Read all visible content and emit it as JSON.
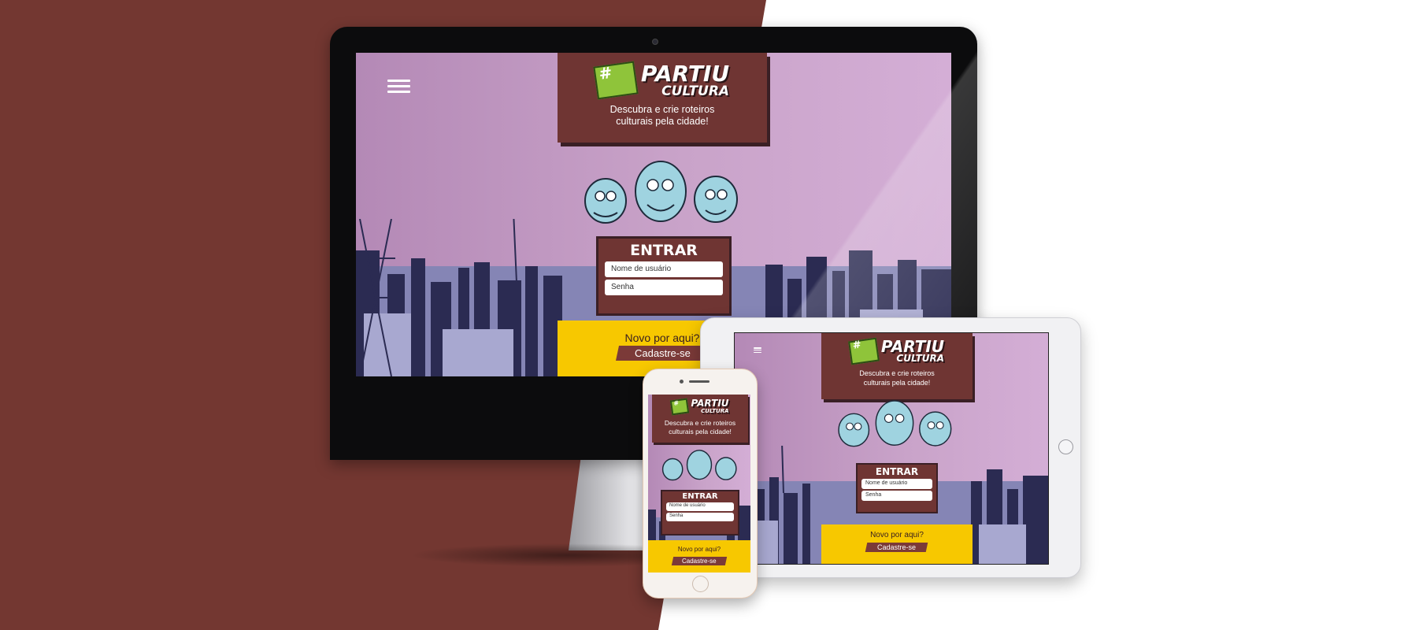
{
  "brand": {
    "logo_line1": "PARTIU",
    "logo_line2": "CULTURA",
    "hash_symbol": "#",
    "tagline_line1": "Descubra e crie roteiros",
    "tagline_line2": "culturais pela cidade!"
  },
  "login": {
    "title": "ENTRAR",
    "username_placeholder": "Nome de usuário",
    "password_placeholder": "Senha"
  },
  "signup": {
    "question": "Novo por aqui?",
    "button_label": "Cadastre-se"
  },
  "icons": {
    "menu": "hamburger-menu-icon"
  },
  "colors": {
    "background_left": "#733731",
    "background_right": "#ffffff",
    "panel": "#6f3533",
    "screen_bg": "#c9a3c9",
    "logo_green": "#8fc43a",
    "signup_yellow": "#f7c800",
    "city_dark": "#2b2b52",
    "city_light": "#8080b0"
  }
}
